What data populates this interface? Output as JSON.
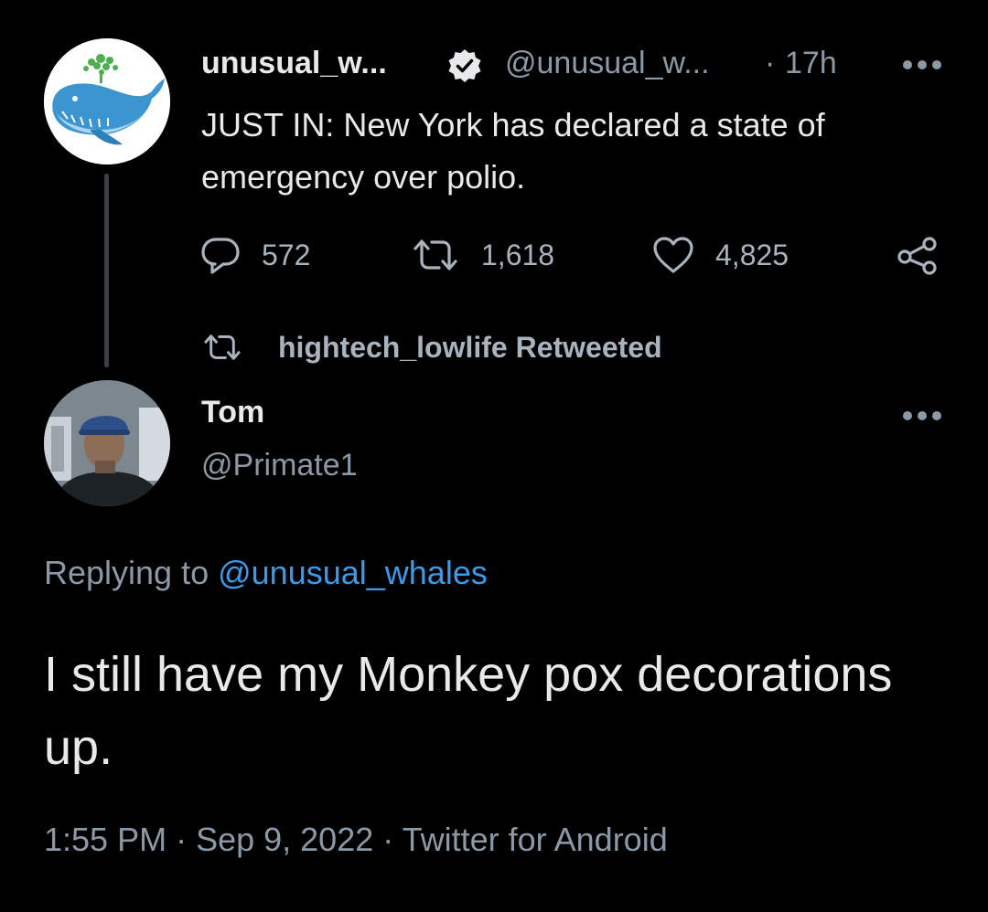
{
  "parent_tweet": {
    "display_name": "unusual_w...",
    "handle": "@unusual_w...",
    "dot": "·",
    "time": "17h",
    "text": "JUST IN: New York has declared a state of emergency over polio.",
    "reply_count": "572",
    "retweet_count": "1,618",
    "like_count": "4,825"
  },
  "retweet_indicator": {
    "label": "hightech_lowlife Retweeted"
  },
  "main_tweet": {
    "display_name": "Tom",
    "handle": "@Primate1",
    "replying_prefix": "Replying to ",
    "replying_handle": "@unusual_whales",
    "text": "I still have my Monkey pox decorations up.",
    "timestamp": "1:55 PM",
    "date": "Sep 9, 2022",
    "source": "Twitter for Android",
    "separator": " · "
  },
  "colors": {
    "background": "#000000",
    "primary_text": "#e7e9ea",
    "secondary_text": "#8b98a5",
    "link": "#3b9bea",
    "thread_line": "#3a3d41"
  },
  "icons": {
    "verified": "verified-badge-icon",
    "more": "more-horizontal-icon",
    "reply": "reply-icon",
    "retweet": "retweet-icon",
    "like": "heart-icon",
    "share": "share-icon"
  }
}
